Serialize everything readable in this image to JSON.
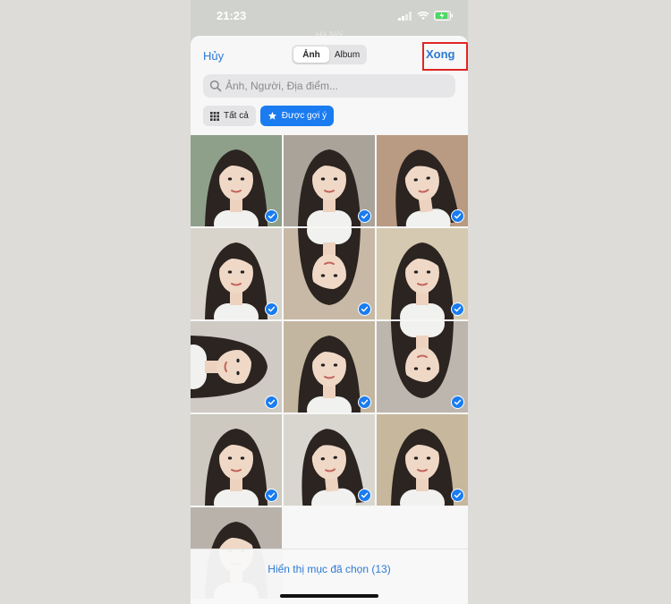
{
  "status": {
    "time": "21:23"
  },
  "background": {
    "city": "Hà Nội"
  },
  "nav": {
    "cancel": "Hủy",
    "tabs": [
      "Ảnh",
      "Album"
    ],
    "active_tab": "Ảnh",
    "done": "Xong"
  },
  "search": {
    "placeholder": "Ảnh, Người, Địa điểm..."
  },
  "filters": {
    "all": "Tất cả",
    "featured": "Được gợi ý"
  },
  "photos": [
    {
      "selected": true
    },
    {
      "selected": true
    },
    {
      "selected": true
    },
    {
      "selected": true
    },
    {
      "selected": true
    },
    {
      "selected": true
    },
    {
      "selected": true
    },
    {
      "selected": true
    },
    {
      "selected": true
    },
    {
      "selected": true
    },
    {
      "selected": true
    },
    {
      "selected": true
    },
    {
      "selected": true
    }
  ],
  "footer": {
    "show_selected": "Hiển thị mục đã chọn (13)"
  },
  "colors": {
    "accent": "#1a7cf0",
    "link": "#2c79d4",
    "highlight": "#e02525"
  }
}
